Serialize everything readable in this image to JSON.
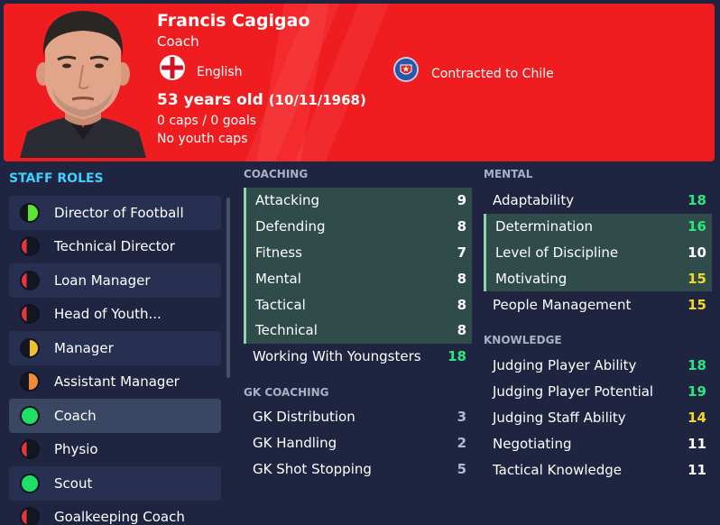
{
  "header": {
    "name": "Francis Cagigao",
    "role": "Coach",
    "nationality": "English",
    "contract": "Contracted to Chile",
    "age": "53 years old",
    "dob": "(10/11/1968)",
    "caps": "0 caps / 0 goals",
    "youth_caps": "No youth caps",
    "colors": {
      "banner": "#f01d20"
    }
  },
  "staff_roles": {
    "title": "STAFF ROLES",
    "items": [
      {
        "label": "Director of Football",
        "suitability": "green-partial"
      },
      {
        "label": "Technical Director",
        "suitability": "red"
      },
      {
        "label": "Loan Manager",
        "suitability": "red"
      },
      {
        "label": "Head of Youth...",
        "suitability": "red"
      },
      {
        "label": "Manager",
        "suitability": "yellow"
      },
      {
        "label": "Assistant Manager",
        "suitability": "orange"
      },
      {
        "label": "Coach",
        "suitability": "green",
        "selected": true
      },
      {
        "label": "Physio",
        "suitability": "red"
      },
      {
        "label": "Scout",
        "suitability": "green"
      },
      {
        "label": "Goalkeeping Coach",
        "suitability": "red"
      }
    ]
  },
  "coaching": {
    "title": "COACHING",
    "items": [
      {
        "label": "Attacking",
        "value": "9"
      },
      {
        "label": "Defending",
        "value": "8"
      },
      {
        "label": "Fitness",
        "value": "7"
      },
      {
        "label": "Mental",
        "value": "8"
      },
      {
        "label": "Tactical",
        "value": "8"
      },
      {
        "label": "Technical",
        "value": "8"
      },
      {
        "label": "Working With Youngsters",
        "value": "18"
      }
    ]
  },
  "gk_coaching": {
    "title": "GK COACHING",
    "items": [
      {
        "label": "GK Distribution",
        "value": "3"
      },
      {
        "label": "GK Handling",
        "value": "2"
      },
      {
        "label": "GK Shot Stopping",
        "value": "5"
      }
    ]
  },
  "mental": {
    "title": "MENTAL",
    "items": [
      {
        "label": "Adaptability",
        "value": "18"
      },
      {
        "label": "Determination",
        "value": "16"
      },
      {
        "label": "Level of Discipline",
        "value": "10"
      },
      {
        "label": "Motivating",
        "value": "15"
      },
      {
        "label": "People Management",
        "value": "15"
      }
    ]
  },
  "knowledge": {
    "title": "KNOWLEDGE",
    "items": [
      {
        "label": "Judging Player Ability",
        "value": "18"
      },
      {
        "label": "Judging Player Potential",
        "value": "19"
      },
      {
        "label": "Judging Staff Ability",
        "value": "14"
      },
      {
        "label": "Negotiating",
        "value": "11"
      },
      {
        "label": "Tactical Knowledge",
        "value": "11"
      }
    ]
  }
}
